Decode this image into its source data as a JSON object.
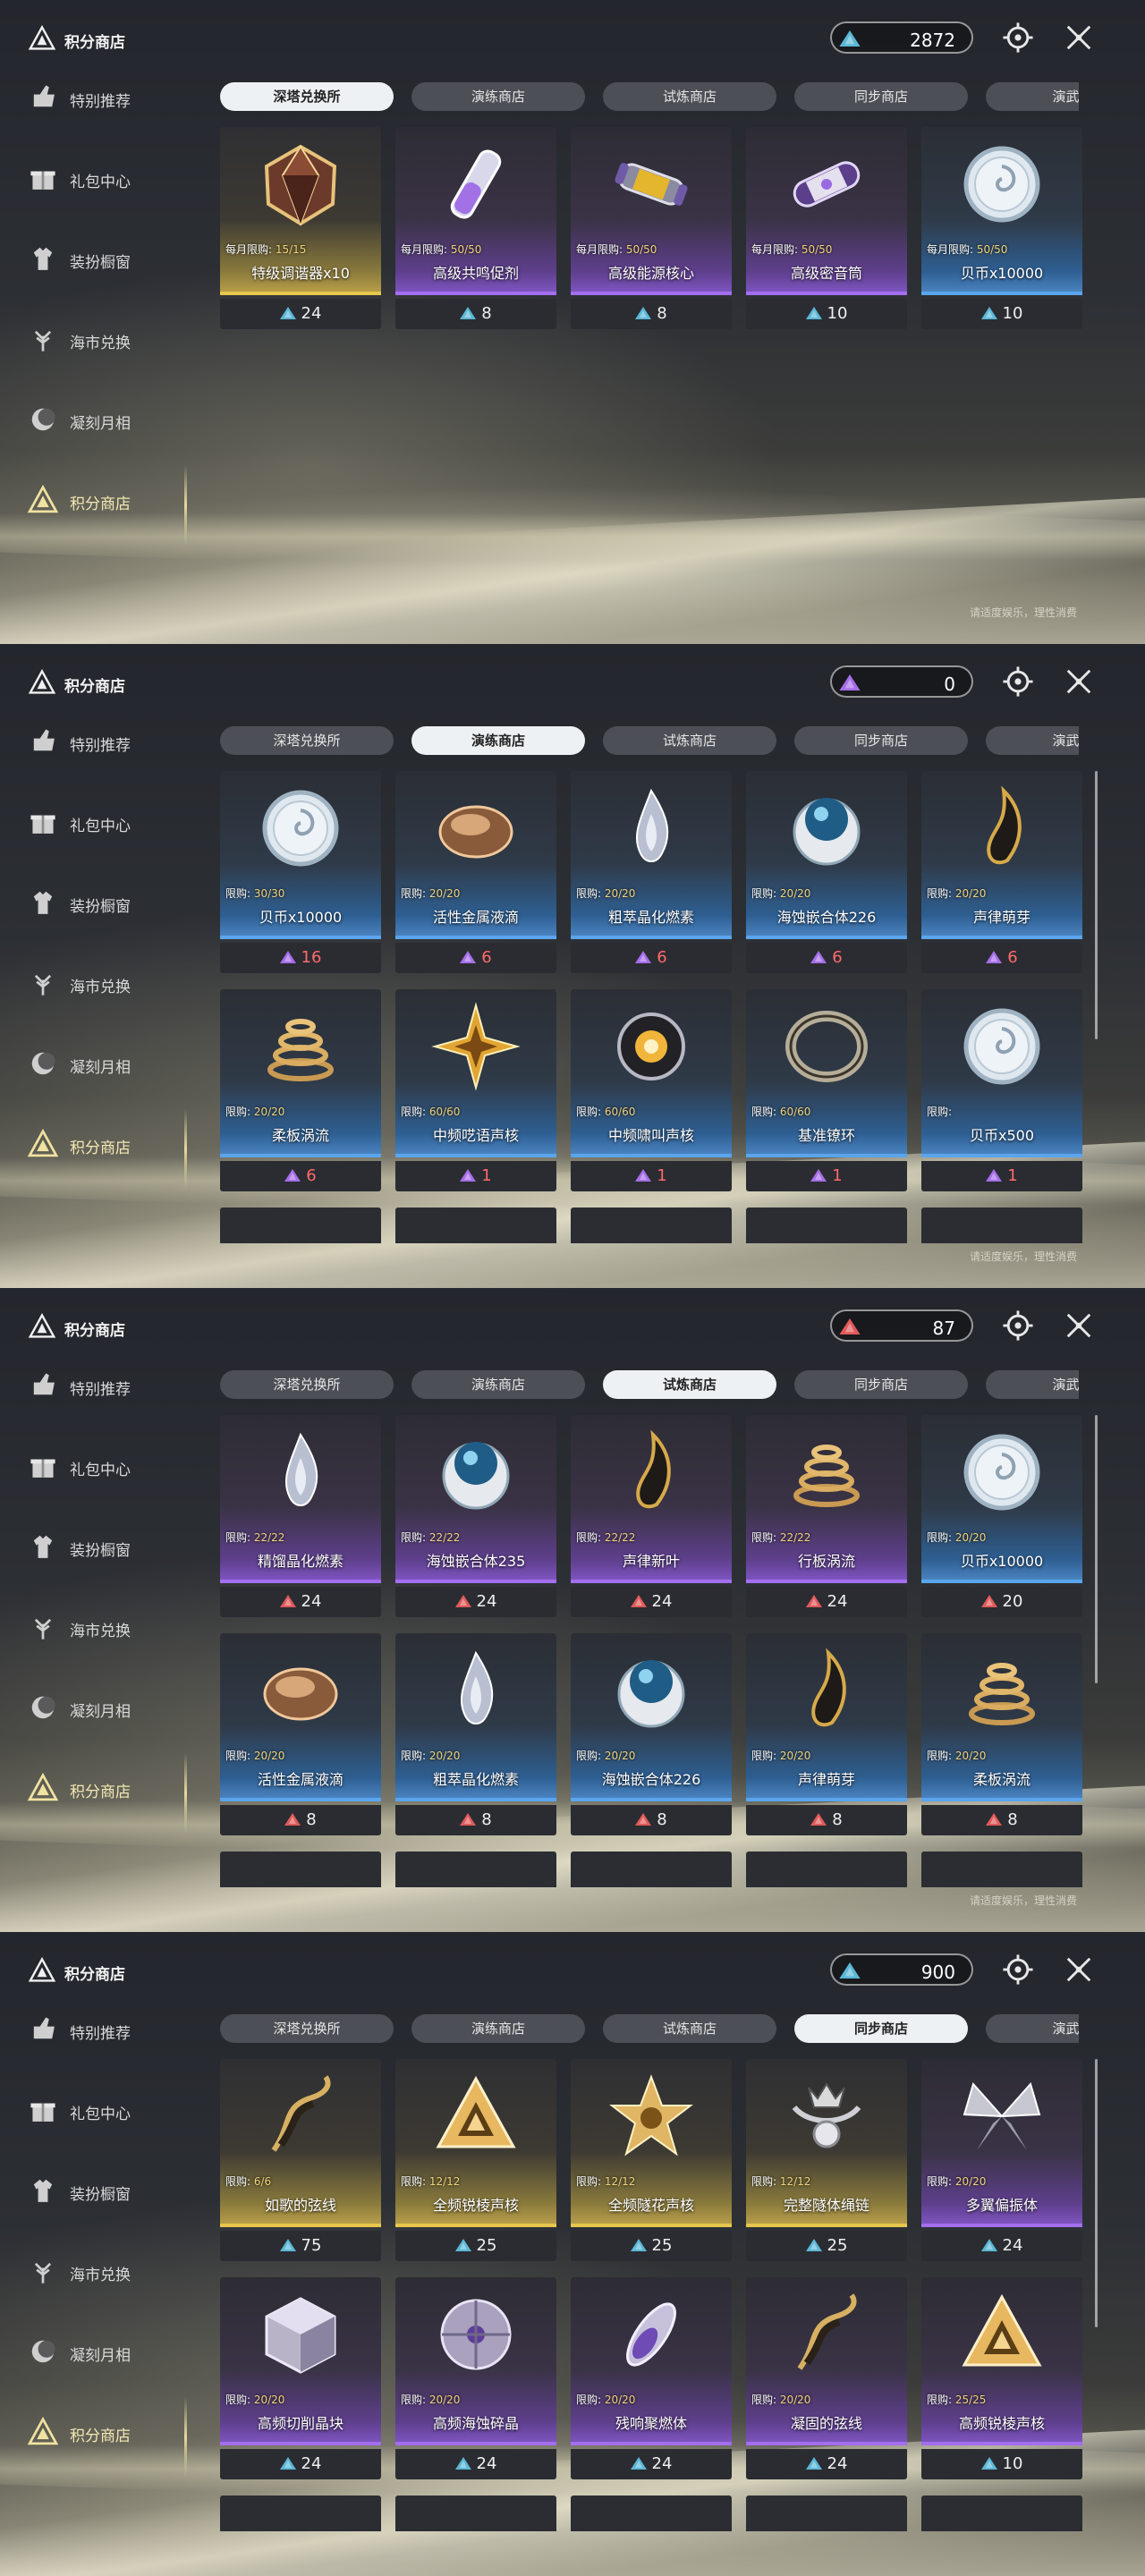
{
  "screens": [
    {
      "app_title": "积分商店",
      "currency": {
        "amount": "2872",
        "color": "#5bb8d6"
      },
      "nav": [
        "特别推荐",
        "礼包中心",
        "装扮橱窗",
        "海市兑换",
        "凝刻月相",
        "积分商店"
      ],
      "tabs": [
        "深塔兑换所",
        "演练商店",
        "试炼商店",
        "同步商店",
        "演武商"
      ],
      "active_tab": 0,
      "footer": "请适度娱乐，理性消费",
      "rows": [
        [
          {
            "limit_label": "每月限购: ",
            "limit": "15/15",
            "name": "特级调谐器x10",
            "price": "24",
            "rarity": "gold",
            "icon": "tuner-gem-icon",
            "price_color": "white"
          },
          {
            "limit_label": "每月限购: ",
            "limit": "50/50",
            "name": "高级共鸣促剂",
            "price": "8",
            "rarity": "purple",
            "icon": "vial-icon",
            "price_color": "white"
          },
          {
            "limit_label": "每月限购: ",
            "limit": "50/50",
            "name": "高级能源核心",
            "price": "8",
            "rarity": "purple",
            "icon": "energy-core-icon",
            "price_color": "white"
          },
          {
            "limit_label": "每月限购: ",
            "limit": "50/50",
            "name": "高级密音筒",
            "price": "10",
            "rarity": "purple",
            "icon": "capsule-icon",
            "price_color": "white"
          },
          {
            "limit_label": "每月限购: ",
            "limit": "50/50",
            "name": "贝币x10000",
            "price": "10",
            "rarity": "blue",
            "icon": "shell-coin-icon",
            "price_color": "white"
          }
        ]
      ],
      "extra_row": false
    },
    {
      "app_title": "积分商店",
      "currency": {
        "amount": "0",
        "color": "#a66ee8"
      },
      "nav": [
        "特别推荐",
        "礼包中心",
        "装扮橱窗",
        "海市兑换",
        "凝刻月相",
        "积分商店"
      ],
      "tabs": [
        "深塔兑换所",
        "演练商店",
        "试炼商店",
        "同步商店",
        "演武商"
      ],
      "active_tab": 1,
      "footer": "请适度娱乐，理性消费",
      "rows": [
        [
          {
            "limit_label": "限购: ",
            "limit": "30/30",
            "name": "贝币x10000",
            "price": "16",
            "rarity": "blue",
            "icon": "shell-coin-icon",
            "price_color": "red"
          },
          {
            "limit_label": "限购: ",
            "limit": "20/20",
            "name": "活性金属液滴",
            "price": "6",
            "rarity": "blue",
            "icon": "metal-drop-icon",
            "price_color": "red"
          },
          {
            "limit_label": "限购: ",
            "limit": "20/20",
            "name": "粗萃晶化燃素",
            "price": "6",
            "rarity": "blue",
            "icon": "crystal-flame-icon",
            "price_color": "red"
          },
          {
            "limit_label": "限购: ",
            "limit": "20/20",
            "name": "海蚀嵌合体226",
            "price": "6",
            "rarity": "blue",
            "icon": "orb-icon",
            "price_color": "red"
          },
          {
            "limit_label": "限购: ",
            "limit": "20/20",
            "name": "声律萌芽",
            "price": "6",
            "rarity": "blue",
            "icon": "sprout-flame-icon",
            "price_color": "red"
          }
        ],
        [
          {
            "limit_label": "限购: ",
            "limit": "20/20",
            "name": "柔板涡流",
            "price": "6",
            "rarity": "blue",
            "icon": "vortex-icon",
            "price_color": "red"
          },
          {
            "limit_label": "限购: ",
            "limit": "60/60",
            "name": "中频呓语声核",
            "price": "1",
            "rarity": "blue",
            "icon": "star-core-icon",
            "price_color": "red"
          },
          {
            "limit_label": "限购: ",
            "limit": "60/60",
            "name": "中频啸叫声核",
            "price": "1",
            "rarity": "blue",
            "icon": "howl-core-icon",
            "price_color": "red"
          },
          {
            "limit_label": "限购: ",
            "limit": "60/60",
            "name": "基准镣环",
            "price": "1",
            "rarity": "blue",
            "icon": "ring-icon",
            "price_color": "red"
          },
          {
            "limit_label": "限购: ",
            "limit": "",
            "name": "贝币x500",
            "price": "1",
            "rarity": "blue",
            "icon": "shell-coin-icon",
            "price_color": "red"
          }
        ]
      ],
      "extra_row": true
    },
    {
      "app_title": "积分商店",
      "currency": {
        "amount": "87",
        "color": "#e05a5a"
      },
      "nav": [
        "特别推荐",
        "礼包中心",
        "装扮橱窗",
        "海市兑换",
        "凝刻月相",
        "积分商店"
      ],
      "tabs": [
        "深塔兑换所",
        "演练商店",
        "试炼商店",
        "同步商店",
        "演武商"
      ],
      "active_tab": 2,
      "footer": "请适度娱乐，理性消费",
      "rows": [
        [
          {
            "limit_label": "限购: ",
            "limit": "22/22",
            "name": "精馏晶化燃素",
            "price": "24",
            "rarity": "purple",
            "icon": "crystal-flame-icon",
            "price_color": "white"
          },
          {
            "limit_label": "限购: ",
            "limit": "22/22",
            "name": "海蚀嵌合体235",
            "price": "24",
            "rarity": "purple",
            "icon": "orb-icon",
            "price_color": "white"
          },
          {
            "limit_label": "限购: ",
            "limit": "22/22",
            "name": "声律新叶",
            "price": "24",
            "rarity": "purple",
            "icon": "sprout-flame-icon",
            "price_color": "white"
          },
          {
            "limit_label": "限购: ",
            "limit": "22/22",
            "name": "行板涡流",
            "price": "24",
            "rarity": "purple",
            "icon": "vortex-icon",
            "price_color": "white"
          },
          {
            "limit_label": "限购: ",
            "limit": "20/20",
            "name": "贝币x10000",
            "price": "20",
            "rarity": "blue",
            "icon": "shell-coin-icon",
            "price_color": "white"
          }
        ],
        [
          {
            "limit_label": "限购: ",
            "limit": "20/20",
            "name": "活性金属液滴",
            "price": "8",
            "rarity": "blue",
            "icon": "metal-drop-icon",
            "price_color": "white"
          },
          {
            "limit_label": "限购: ",
            "limit": "20/20",
            "name": "粗萃晶化燃素",
            "price": "8",
            "rarity": "blue",
            "icon": "crystal-flame-icon",
            "price_color": "white"
          },
          {
            "limit_label": "限购: ",
            "limit": "20/20",
            "name": "海蚀嵌合体226",
            "price": "8",
            "rarity": "blue",
            "icon": "orb-icon",
            "price_color": "white"
          },
          {
            "limit_label": "限购: ",
            "limit": "20/20",
            "name": "声律萌芽",
            "price": "8",
            "rarity": "blue",
            "icon": "sprout-flame-icon",
            "price_color": "white"
          },
          {
            "limit_label": "限购: ",
            "limit": "20/20",
            "name": "柔板涡流",
            "price": "8",
            "rarity": "blue",
            "icon": "vortex-icon",
            "price_color": "white"
          }
        ]
      ],
      "extra_row": true
    },
    {
      "app_title": "积分商店",
      "currency": {
        "amount": "900",
        "color": "#5bb8d6"
      },
      "nav": [
        "特别推荐",
        "礼包中心",
        "装扮橱窗",
        "海市兑换",
        "凝刻月相",
        "积分商店"
      ],
      "tabs": [
        "深塔兑换所",
        "演练商店",
        "试炼商店",
        "同步商店",
        "演武商"
      ],
      "active_tab": 3,
      "footer": "",
      "rows": [
        [
          {
            "limit_label": "限购: ",
            "limit": "6/6",
            "name": "如歌的弦线",
            "price": "75",
            "rarity": "gold",
            "icon": "string-icon",
            "price_color": "white"
          },
          {
            "limit_label": "限购: ",
            "limit": "12/12",
            "name": "全频锐棱声核",
            "price": "25",
            "rarity": "gold",
            "icon": "prism-core-icon",
            "price_color": "white"
          },
          {
            "limit_label": "限购: ",
            "limit": "12/12",
            "name": "全频隧花声核",
            "price": "25",
            "rarity": "gold",
            "icon": "flower-core-icon",
            "price_color": "white"
          },
          {
            "limit_label": "限购: ",
            "limit": "12/12",
            "name": "完整隧体绳链",
            "price": "25",
            "rarity": "gold",
            "icon": "chain-icon",
            "price_color": "white"
          },
          {
            "limit_label": "限购: ",
            "limit": "20/20",
            "name": "多翼偏振体",
            "price": "24",
            "rarity": "purple",
            "icon": "wings-icon",
            "price_color": "white"
          }
        ],
        [
          {
            "limit_label": "限购: ",
            "limit": "20/20",
            "name": "高频切削晶块",
            "price": "24",
            "rarity": "purple",
            "icon": "cube-icon",
            "price_color": "white"
          },
          {
            "limit_label": "限购: ",
            "limit": "20/20",
            "name": "高频海蚀碎晶",
            "price": "24",
            "rarity": "purple",
            "icon": "shard-disc-icon",
            "price_color": "white"
          },
          {
            "limit_label": "限购: ",
            "limit": "20/20",
            "name": "残响聚燃体",
            "price": "24",
            "rarity": "purple",
            "icon": "pod-icon",
            "price_color": "white"
          },
          {
            "limit_label": "限购: ",
            "limit": "20/20",
            "name": "凝固的弦线",
            "price": "24",
            "rarity": "purple",
            "icon": "string-icon",
            "price_color": "white"
          },
          {
            "limit_label": "限购: ",
            "limit": "25/25",
            "name": "高频锐棱声核",
            "price": "10",
            "rarity": "purple",
            "icon": "prism-core-icon",
            "price_color": "white"
          }
        ]
      ],
      "extra_row": true
    }
  ]
}
